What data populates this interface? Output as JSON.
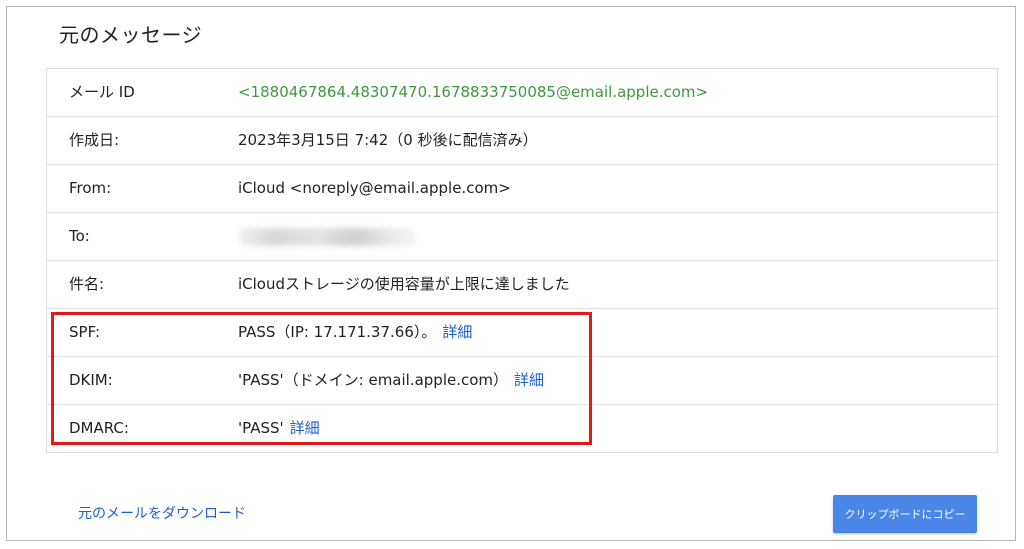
{
  "title": "元のメッセージ",
  "rows": [
    {
      "label": "メール ID",
      "value": "<1880467864.48307470.1678833750085@email.apple.com>"
    },
    {
      "label": "作成日:",
      "value": "2023年3月15日 7:42（0 秒後に配信済み）"
    },
    {
      "label": "From:",
      "value": "iCloud <noreply@email.apple.com>"
    },
    {
      "label": "To:",
      "value": ""
    },
    {
      "label": "件名:",
      "value": "iCloudストレージの使用容量が上限に達しました"
    },
    {
      "label": "SPF:",
      "value": "PASS（IP: 17.171.37.66）。",
      "link": "詳細"
    },
    {
      "label": "DKIM:",
      "value": "'PASS'（ドメイン: email.apple.com）",
      "link": "詳細"
    },
    {
      "label": "DMARC:",
      "value": "'PASS'",
      "link": "詳細"
    }
  ],
  "download_link": "元のメールをダウンロード",
  "copy_button": "クリップボードにコピー",
  "colors": {
    "link": "#1a5fd0",
    "message_id": "#3c9a3c",
    "highlight_box": "#e01a1a",
    "button": "#4a86e8"
  }
}
